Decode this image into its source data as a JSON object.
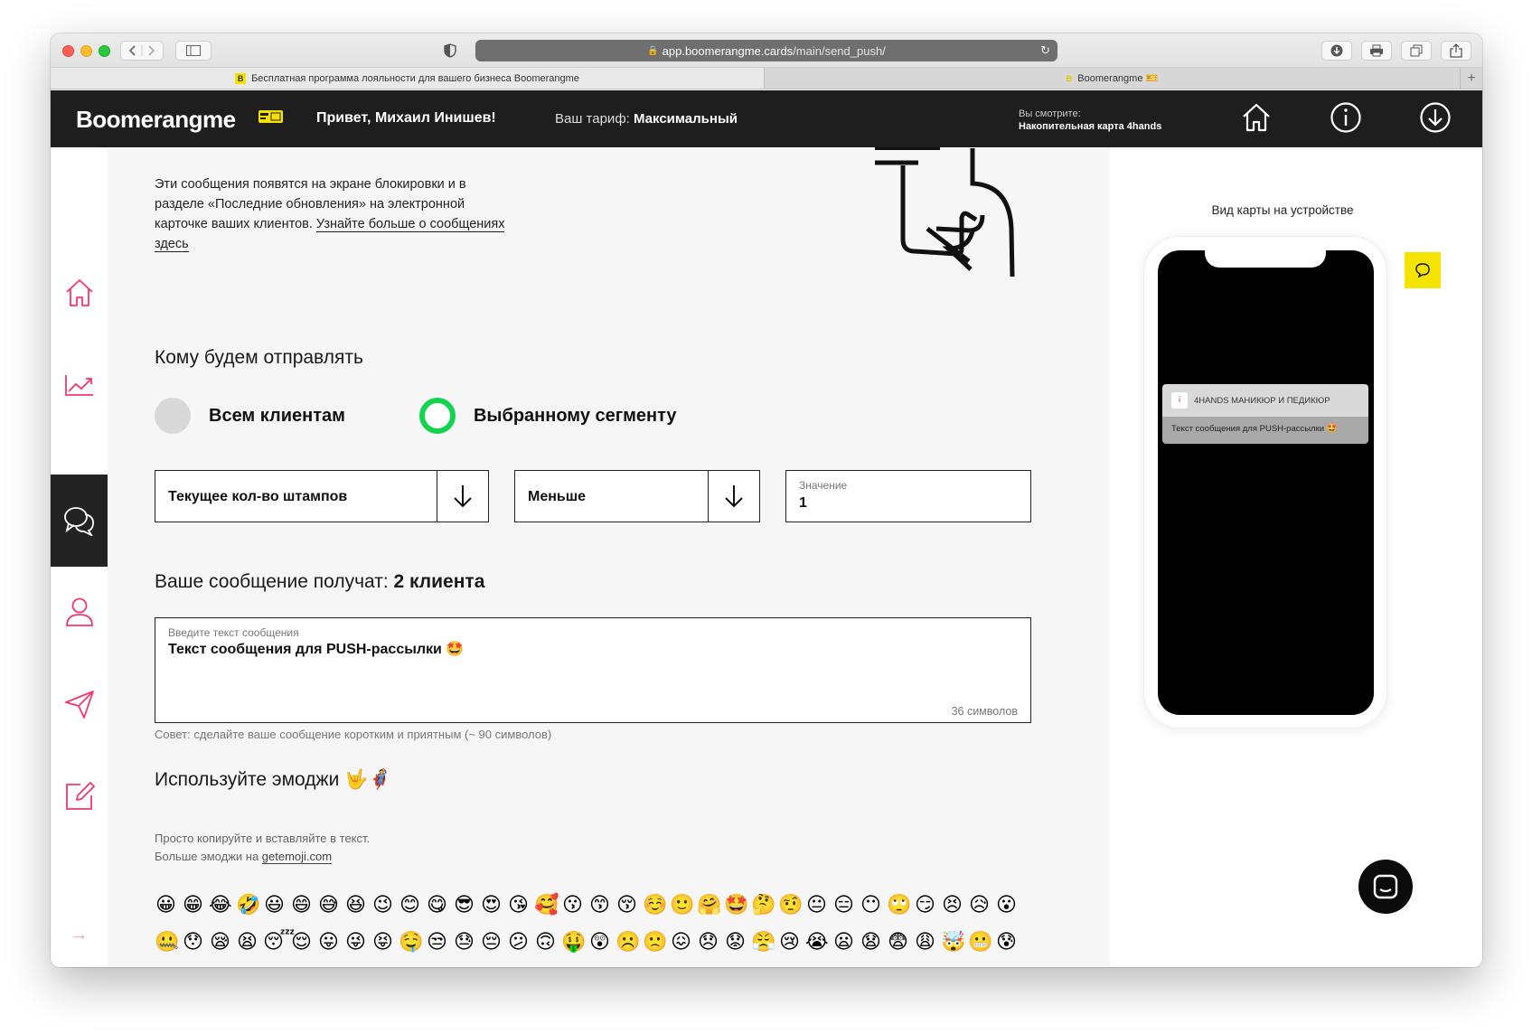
{
  "browser": {
    "url_host": "app.boomerangme.cards",
    "url_path": "/main/send_push/",
    "tabs": [
      {
        "favicon": "B",
        "title": "Бесплатная программа лояльности для вашего бизнеса Boomerangme"
      },
      {
        "favicon": "B",
        "title": "Boomerangme 🎫"
      }
    ],
    "add_tab": "+"
  },
  "header": {
    "logo": "Boomerangme",
    "greeting": "Привет, Михаил Инишев!",
    "tariff_label": "Ваш тариф:",
    "tariff_value": "Максимальный",
    "viewing_label": "Вы смотрите:",
    "viewing_value": "Накопительная карта 4hands",
    "icons": [
      "home-icon",
      "info-icon",
      "download-icon"
    ]
  },
  "sidebar": {
    "items": [
      {
        "name": "home-icon",
        "active": false
      },
      {
        "name": "chart-icon",
        "active": false
      },
      {
        "name": "chat-icon",
        "active": true
      },
      {
        "name": "user-icon",
        "active": false
      },
      {
        "name": "send-icon",
        "active": false
      },
      {
        "name": "edit-icon",
        "active": false
      }
    ],
    "collapse": "→"
  },
  "main": {
    "intro_text": "Эти сообщения появятся на экране блокировки и в разделе «Последние обновления» на электронной карточке ваших клиентов. ",
    "intro_link": "Узнайте больше о сообщениях здесь",
    "recipients_heading": "Кому будем отправлять",
    "radio_all": "Всем клиентам",
    "radio_segment": "Выбранному сегменту",
    "filter_field": "Текущее кол-во штампов",
    "operator_field": "Меньше",
    "value_label": "Значение",
    "value": "1",
    "recipients_text": "Ваше сообщение получат:",
    "recipients_count": "2 клиента",
    "message_label": "Введите текст сообщения",
    "message_text": "Текст сообщения для PUSH-рассылки 🤩",
    "char_count": "36 символов",
    "tip": "Совет: сделайте ваше сообщение коротким и приятным (~ 90 символов)",
    "emoji_heading": "Используйте эмоджи 🤟🦸",
    "emoji_info_1": "Просто копируйте и вставляйте в текст.",
    "emoji_info_2": "Больше эмоджи на ",
    "emoji_link": "getemoji.com",
    "emoji_row_1": [
      "😀",
      "😁",
      "😂",
      "🤣",
      "😃",
      "😄",
      "😅",
      "😆",
      "😉",
      "😊",
      "😋",
      "😎",
      "😍",
      "😘",
      "🥰",
      "😗",
      "😙",
      "😚",
      "☺️",
      "🙂",
      "🤗",
      "🤩",
      "🤔",
      "🤨",
      "😐",
      "😑",
      "😶",
      "🙄",
      "😏",
      "😣",
      "😥",
      "😮"
    ],
    "emoji_row_2": [
      "🤐",
      "😯",
      "😪",
      "😫",
      "😴",
      "😌",
      "😛",
      "😜",
      "😝",
      "🤤",
      "😒",
      "😓",
      "😔",
      "😕",
      "🙃",
      "🤑",
      "😲",
      "☹️",
      "🙁",
      "😖",
      "😞",
      "😟",
      "😤",
      "😢",
      "😭",
      "😦",
      "😧",
      "😨",
      "😩",
      "🤯",
      "😬",
      "😰"
    ]
  },
  "preview": {
    "title": "Вид карты на устройстве",
    "notif_app": "4HANDS МАНИКЮР И ПЕДИКЮР",
    "notif_text": "Текст сообщения для PUSH-рассылки 🤩"
  }
}
